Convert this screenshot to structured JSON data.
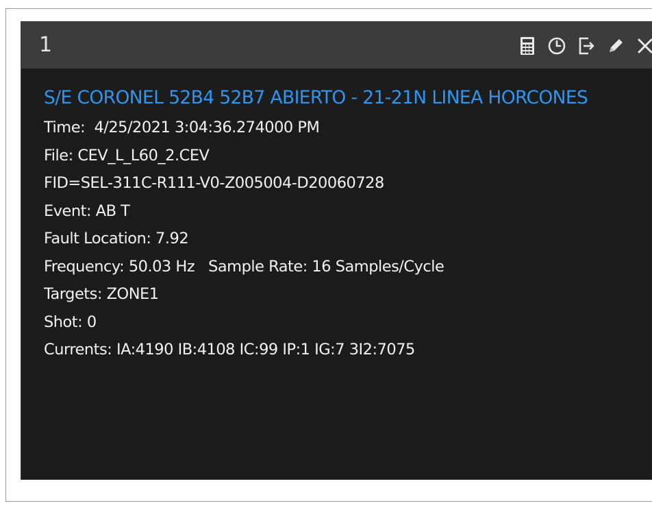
{
  "window": {
    "number": "1"
  },
  "toolbar": {
    "buttons": [
      {
        "icon": "calculator-icon",
        "label": "calculator"
      },
      {
        "icon": "clock-icon",
        "label": "time"
      },
      {
        "icon": "export-icon",
        "label": "export"
      },
      {
        "icon": "pencil-icon",
        "label": "edit"
      },
      {
        "icon": "close-icon",
        "label": "close"
      }
    ]
  },
  "event": {
    "title": "S/E CORONEL 52B4 52B7 ABIERTO - 21-21N LINEA HORCONES",
    "time": "Time:  4/25/2021 3:04:36.274000 PM",
    "file": "File: CEV_L_L60_2.CEV",
    "fid": "FID=SEL-311C-R111-V0-Z005004-D20060728",
    "event_type": "Event: AB T",
    "fault_location": "Fault Location: 7.92",
    "frequency_sample": "Frequency: 50.03 Hz   Sample Rate: 16 Samples/Cycle",
    "targets": "Targets: ZONE1",
    "shot": "Shot: 0",
    "currents": "Currents: IA:4190 IB:4108 IC:99 IP:1 IG:7 3I2:7075"
  },
  "colors": {
    "panel_bg": "#1c1c1c",
    "titlebar_bg": "#3c3c3c",
    "title_accent": "#2f95f0",
    "text": "#f2f2f2"
  }
}
